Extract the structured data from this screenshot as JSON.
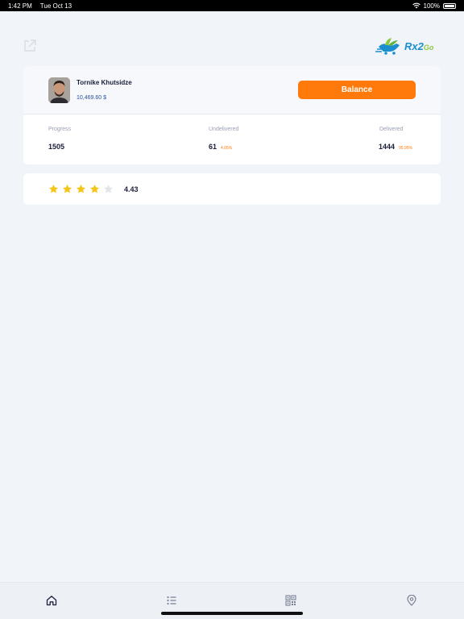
{
  "status_bar": {
    "time": "1:42 PM",
    "date": "Tue Oct 13",
    "battery": "100%",
    "battery_level": 1.0
  },
  "header": {
    "logo_text_main": "Rx2",
    "logo_text_sub": "Go",
    "share_icon": "share-external-icon"
  },
  "profile": {
    "name": "Tornike Khutsidze",
    "balance": "10,469.60 $",
    "balance_button_label": "Balance"
  },
  "stats": [
    {
      "label": "Progress",
      "value": "1505",
      "percent": ""
    },
    {
      "label": "Undelivered",
      "value": "61",
      "percent": "4.05%"
    },
    {
      "label": "Delivered",
      "value": "1444",
      "percent": "95.95%"
    }
  ],
  "rating": {
    "value": "4.43",
    "filled_stars": 4,
    "total_stars": 5
  },
  "tab_bar": {
    "tabs": [
      "home-icon",
      "list-icon",
      "qr-code-icon",
      "location-pin-icon"
    ],
    "active": "home-icon"
  },
  "colors": {
    "accent": "#ff7a0a",
    "star_filled": "#f5c518",
    "star_empty": "#e2e5ea",
    "background": "#f1f5f9",
    "logo_blue": "#1a8fd0",
    "logo_green": "#8cc63f"
  }
}
